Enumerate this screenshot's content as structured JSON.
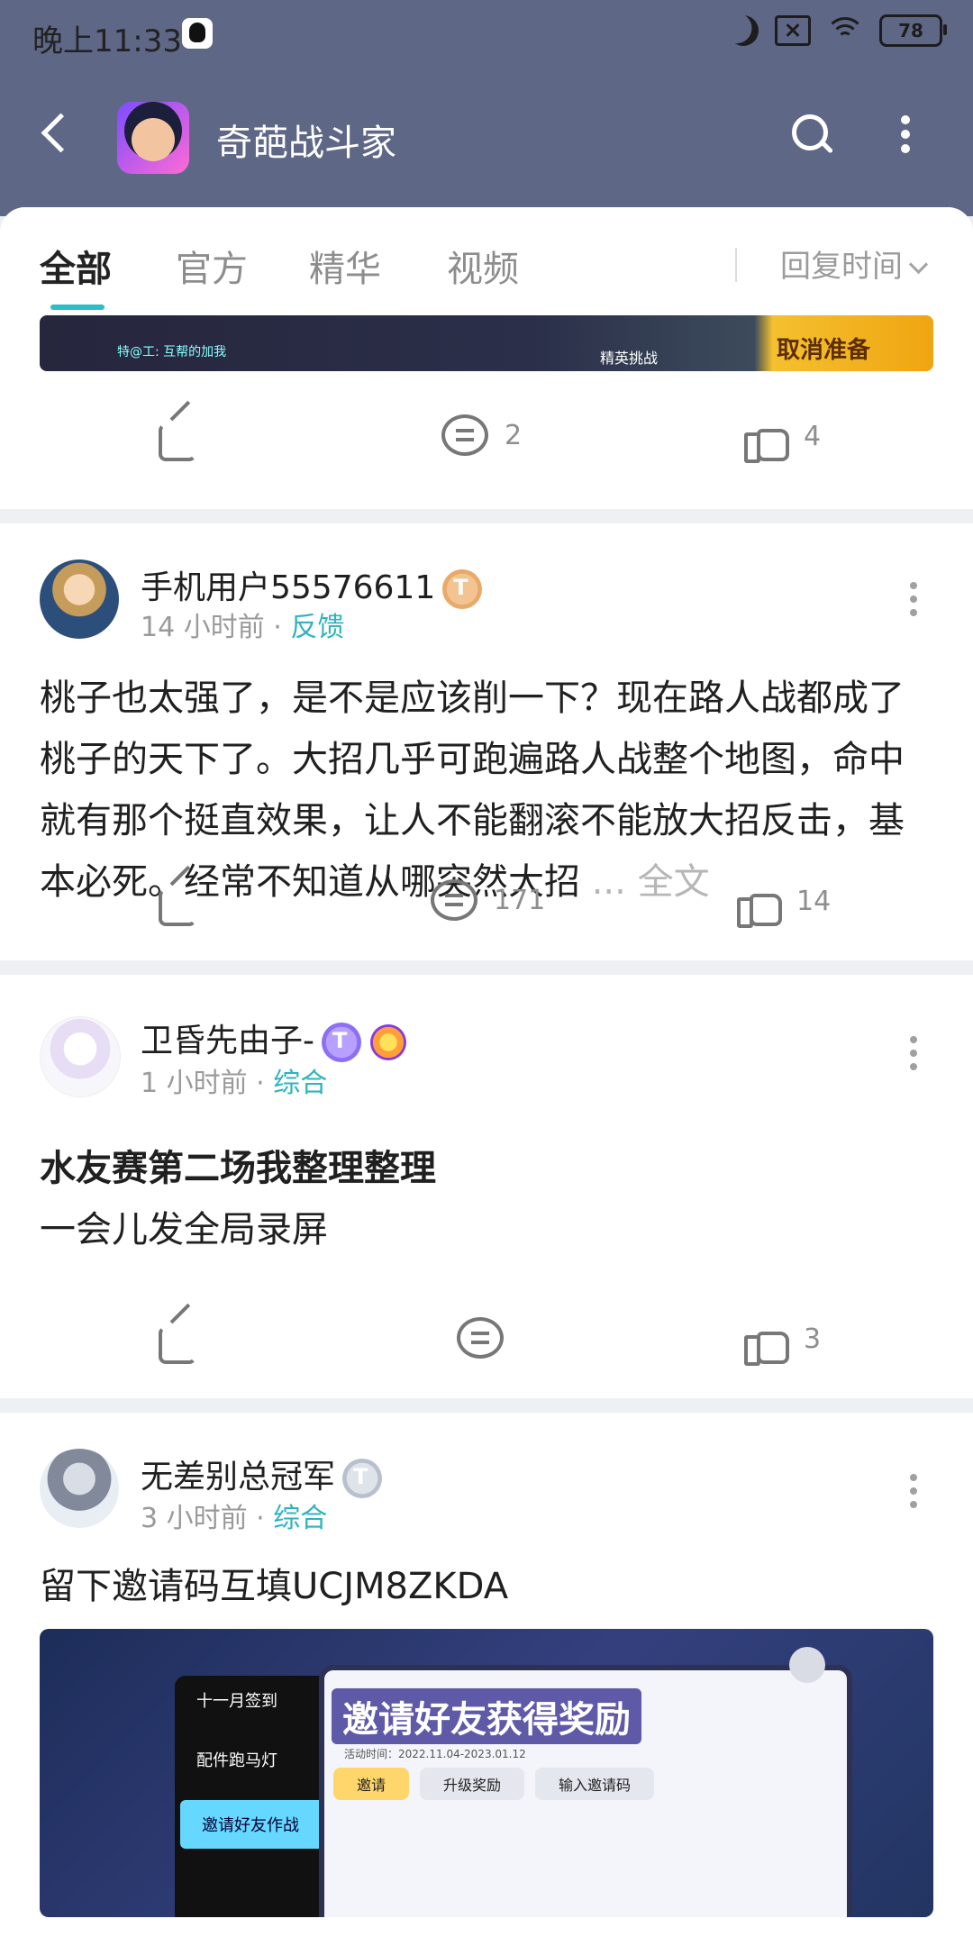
{
  "status": {
    "time": "晚上11:33",
    "battery": "78"
  },
  "header": {
    "back_label": "",
    "title": "奇葩战斗家"
  },
  "tabs": [
    {
      "label": "全部"
    },
    {
      "label": "官方"
    },
    {
      "label": "精华"
    },
    {
      "label": "视频"
    }
  ],
  "sort_label": "回复时间",
  "top_strip": {
    "chat_text": "特@工: 互帮的加我",
    "button": "取消准备",
    "mode": "精英挑战"
  },
  "row1": {
    "share": "",
    "comments": "2",
    "likes": "4"
  },
  "post1": {
    "user": "手机用户55576611",
    "time": "14 小时前",
    "dot": "·",
    "category": "反馈",
    "text": "桃子也太强了，是不是应该削一下？现在路人战都成了桃子的天下了。大招几乎可跑遍路人战整个地图，命中就有那个挺直效果，让人不能翻滚不能放大招反击，基本必死。经常不知道从哪突然大招",
    "more": "... 全文",
    "comments": "171",
    "likes": "14"
  },
  "post2": {
    "user": "卫昏先由子-",
    "time": "1 小时前",
    "dot": "·",
    "category": "综合",
    "title": "水友赛第二场我整理整理",
    "subtitle": "一会儿发全局录屏",
    "likes": "3"
  },
  "post3": {
    "user": "无差别总冠军",
    "time": "3 小时前",
    "dot": "·",
    "category": "综合",
    "text": "留下邀请码互填UCJM8ZKDA",
    "image_title": "邀请好友获得奖励",
    "image_menu": [
      "十一月签到",
      "配件跑马灯",
      "邀请好友作战"
    ],
    "image_tabs": [
      "邀请",
      "升级奖励",
      "输入邀请码"
    ],
    "image_date": "活动时间：2022.11.04-2023.01.12"
  }
}
